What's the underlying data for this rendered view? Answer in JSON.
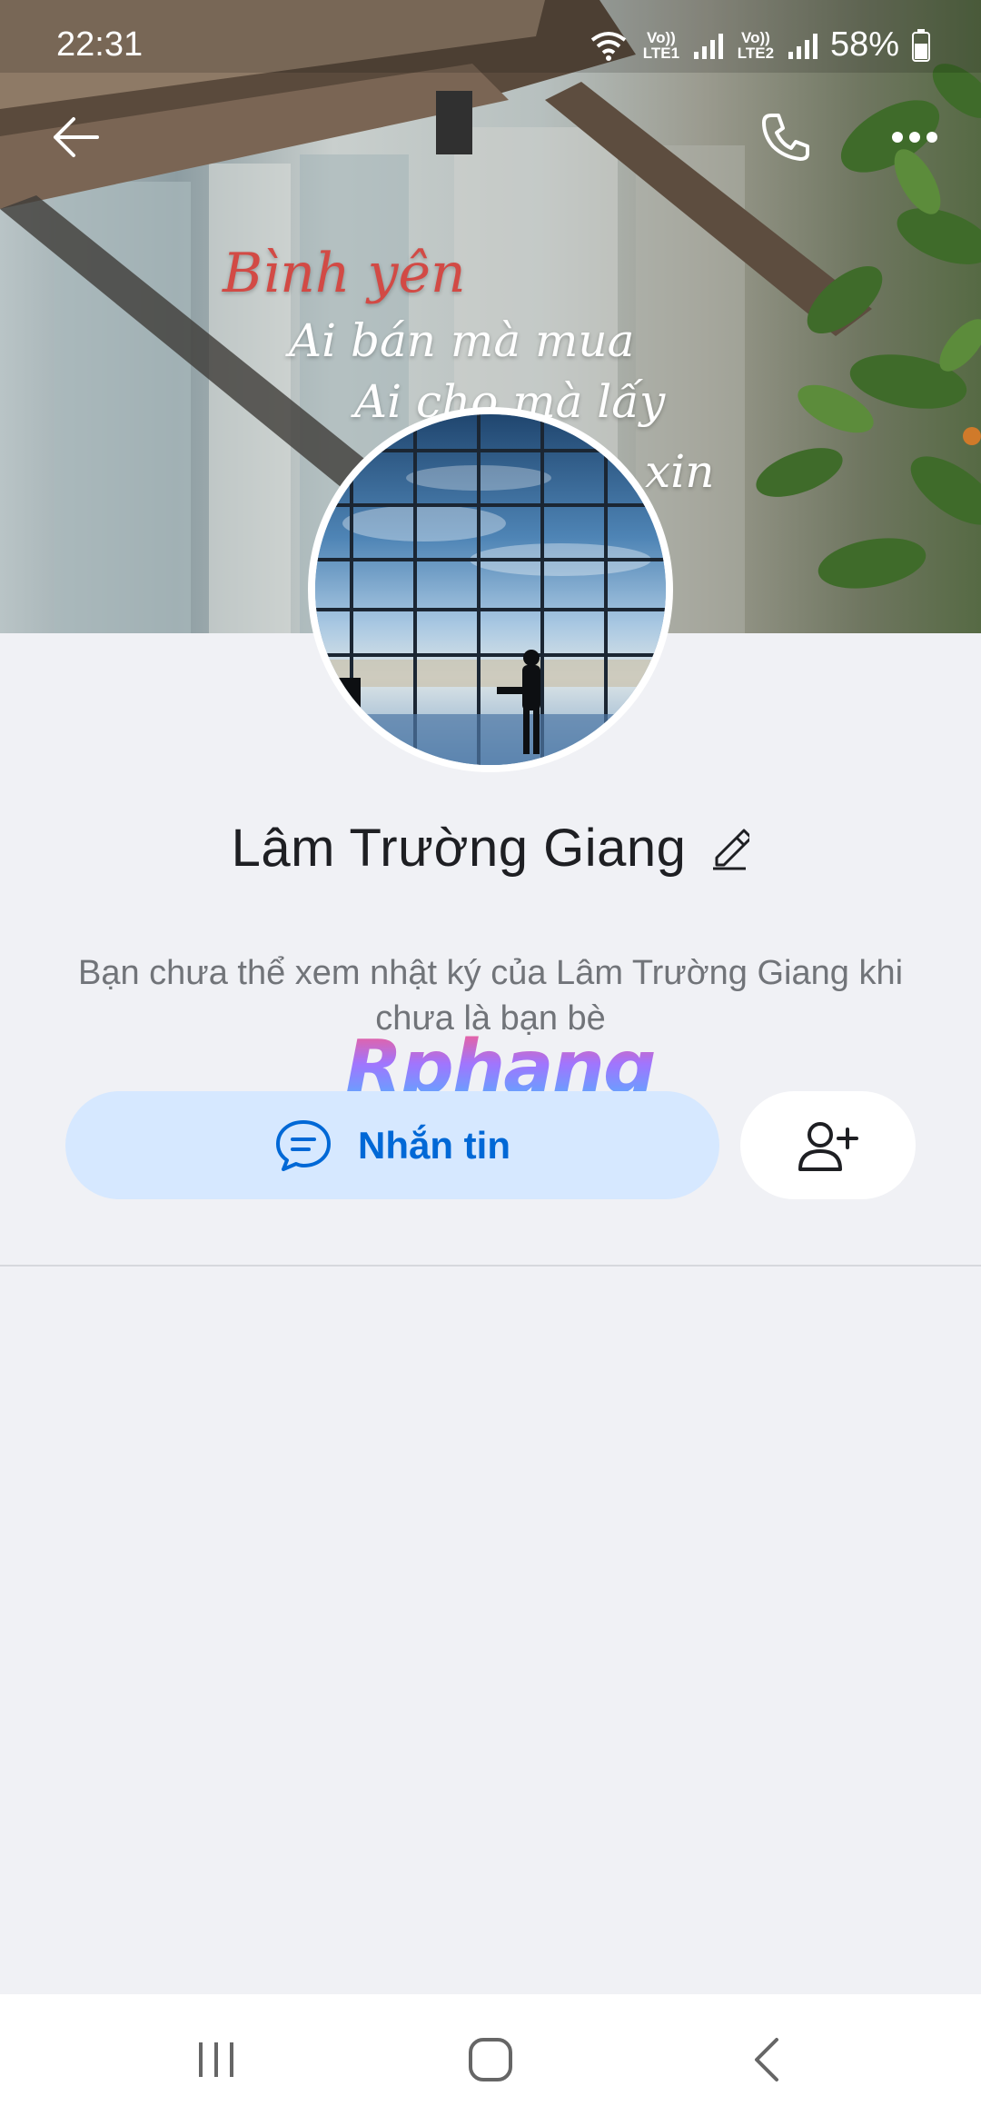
{
  "status_bar": {
    "time": "22:31",
    "network_sim1": "Vo)) LTE1",
    "network_sim2": "Vo)) LTE2",
    "battery": "58%",
    "icons": [
      "wifi-icon",
      "signal-sim1-icon",
      "signal-sim2-icon",
      "battery-icon"
    ]
  },
  "top_bar": {
    "back_icon": "arrow-left-icon",
    "call_icon": "phone-icon",
    "more_icon": "more-horizontal-icon"
  },
  "cover": {
    "poem_title": "Bình yên",
    "poem_line1": "Ai bán mà mua",
    "poem_line2": "Ai cho mà lấy",
    "poem_line3": "xin"
  },
  "profile": {
    "name": "Lâm Trường Giang",
    "edit_icon": "pencil-icon",
    "notice": "Bạn chưa thể xem nhật ký của Lâm Trường Giang khi chưa là bạn bè"
  },
  "watermark": "Rphang",
  "actions": {
    "message_label": "Nhắn tin",
    "message_icon": "chat-bubble-icon",
    "add_friend_icon": "add-friend-icon"
  },
  "nav_bar": {
    "recent_icon": "recent-apps-icon",
    "home_icon": "home-icon",
    "back_icon": "nav-back-icon"
  },
  "colors": {
    "accent": "#0068d6",
    "message_button_bg": "#d6e8ff",
    "page_bg": "#f0f1f5",
    "poem_title": "#d24a45"
  }
}
